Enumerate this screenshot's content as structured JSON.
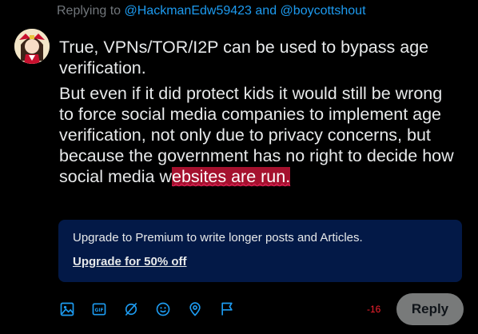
{
  "replying": {
    "prefix": "Replying to",
    "mention1": "@HackmanEdw59423",
    "joiner": "and",
    "mention2": "@boycottshout"
  },
  "compose": {
    "paragraph1": "True, VPNs/TOR/I2P can be used to bypass age verification.",
    "paragraph2_main": "But even if it did protect kids it would still be wrong to force social media companies to implement age verification, not only due to privacy concerns, but because the government has no right to decide how social media w",
    "paragraph2_overflow": "ebsites are run."
  },
  "premium": {
    "text": "Upgrade to Premium to write longer posts and Articles.",
    "link": "Upgrade for 50% off"
  },
  "toolbar": {
    "icons": [
      "image-icon",
      "gif-icon",
      "grok-icon",
      "emoji-icon",
      "location-icon",
      "flag-icon"
    ],
    "accent": "#1d9bf0"
  },
  "counter": "-16",
  "reply_button": "Reply",
  "colors": {
    "background": "#000000",
    "accent": "#1d9bf0",
    "overflow_highlight": "#a5112e",
    "premium_bg": "#031947",
    "counter": "#f4212e"
  }
}
